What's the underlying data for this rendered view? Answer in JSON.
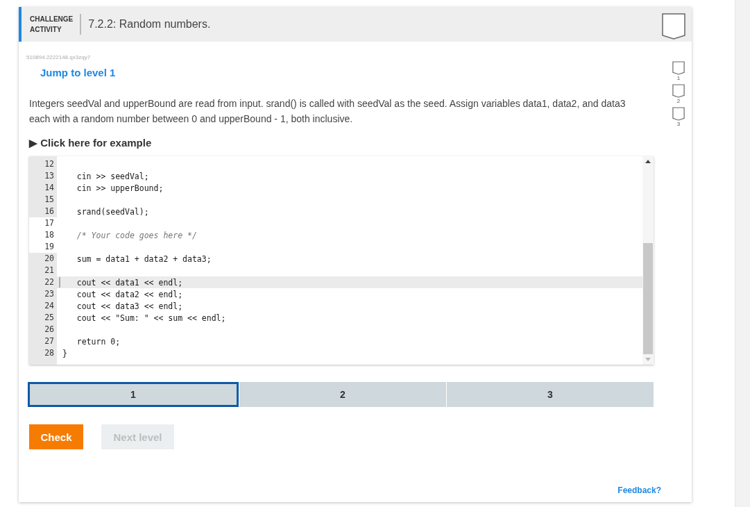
{
  "header": {
    "label_line1": "CHALLENGE",
    "label_line2": "ACTIVITY",
    "title": "7.2.2: Random numbers."
  },
  "activity_id": "510894.2222148.qx3zqy7",
  "jump_link": "Jump to level 1",
  "instructions": "Integers seedVal and upperBound are read from input. srand() is called with seedVal as the seed. Assign variables data1, data2, and data3 each with a random number between 0 and upperBound - 1, both inclusive.",
  "example_toggle": {
    "arrow": "▶",
    "label": "Click here for example",
    "expanded": false
  },
  "code_lines": [
    {
      "number": "12",
      "editable": false,
      "active": false
    },
    {
      "number": "13",
      "text": "   cin >> seedVal;",
      "kind": "code",
      "editable": false,
      "active": false
    },
    {
      "number": "14",
      "text": "   cin >> upperBound;",
      "kind": "code",
      "editable": false,
      "active": false
    },
    {
      "number": "15",
      "editable": false,
      "active": false
    },
    {
      "number": "16",
      "text": "   srand(seedVal);",
      "kind": "code",
      "editable": false,
      "active": false
    },
    {
      "number": "17",
      "editable": true,
      "active": false
    },
    {
      "number": "18",
      "text": "   /* Your code goes here */",
      "kind": "comment",
      "editable": true,
      "active": false
    },
    {
      "number": "19",
      "editable": true,
      "active": false
    },
    {
      "number": "20",
      "text": "   sum = data1 + data2 + data3;",
      "kind": "code",
      "editable": false,
      "active": false
    },
    {
      "number": "21",
      "editable": false,
      "active": false
    },
    {
      "number": "22",
      "text": "   cout << data1 << endl;",
      "kind": "code",
      "editable": false,
      "active": true
    },
    {
      "number": "23",
      "text": "   cout << data2 << endl;",
      "kind": "code",
      "editable": false,
      "active": false
    },
    {
      "number": "24",
      "text": "   cout << data3 << endl;",
      "kind": "code",
      "editable": false,
      "active": false
    },
    {
      "number": "25",
      "text": "   cout << \"Sum: \" << sum << endl;",
      "kind": "code",
      "editable": false,
      "active": false
    },
    {
      "number": "26",
      "editable": false,
      "active": false
    },
    {
      "number": "27",
      "text": "   return 0;",
      "kind": "code",
      "editable": false,
      "active": false
    },
    {
      "number": "28",
      "text": "}",
      "kind": "code",
      "editable": false,
      "active": false
    }
  ],
  "level_tabs": [
    {
      "label": "1",
      "selected": true
    },
    {
      "label": "2",
      "selected": false
    },
    {
      "label": "3",
      "selected": false
    }
  ],
  "level_markers": [
    {
      "label": "1"
    },
    {
      "label": "2"
    },
    {
      "label": "3"
    }
  ],
  "buttons": {
    "check": "Check",
    "next_level": {
      "label": "Next level",
      "disabled": true
    }
  },
  "feedback_link": "Feedback?"
}
